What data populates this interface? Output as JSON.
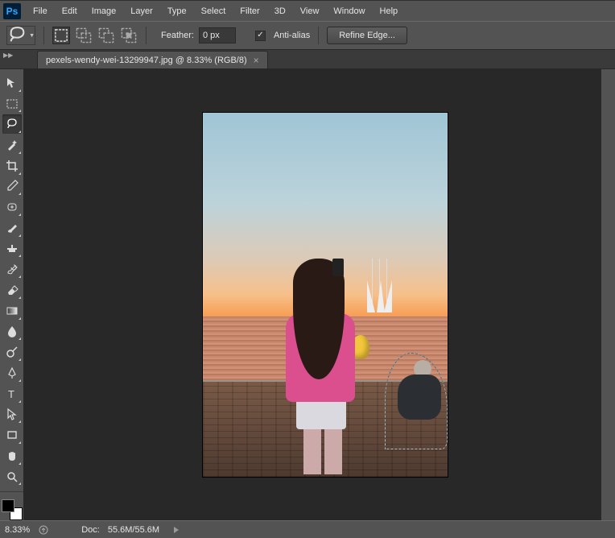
{
  "menubar": {
    "items": [
      "File",
      "Edit",
      "Image",
      "Layer",
      "Type",
      "Select",
      "Filter",
      "3D",
      "View",
      "Window",
      "Help"
    ]
  },
  "optionsbar": {
    "feather_label": "Feather:",
    "feather_value": "0 px",
    "antialias_label": "Anti-alias",
    "antialias_checked": true,
    "refine_edge_label": "Refine Edge..."
  },
  "document": {
    "tab_label": "pexels-wendy-wei-13299947.jpg @ 8.33% (RGB/8)"
  },
  "tools": [
    {
      "name": "move-tool"
    },
    {
      "name": "rectangular-marquee-tool"
    },
    {
      "name": "lasso-tool",
      "active": true
    },
    {
      "name": "magic-wand-tool"
    },
    {
      "name": "crop-tool"
    },
    {
      "name": "eyedropper-tool"
    },
    {
      "name": "healing-brush-tool"
    },
    {
      "name": "brush-tool"
    },
    {
      "name": "clone-stamp-tool"
    },
    {
      "name": "history-brush-tool"
    },
    {
      "name": "eraser-tool"
    },
    {
      "name": "gradient-tool"
    },
    {
      "name": "blur-tool"
    },
    {
      "name": "dodge-tool"
    },
    {
      "name": "pen-tool"
    },
    {
      "name": "type-tool"
    },
    {
      "name": "path-selection-tool"
    },
    {
      "name": "rectangle-shape-tool"
    },
    {
      "name": "hand-tool"
    },
    {
      "name": "zoom-tool"
    }
  ],
  "selection_mode_icons": [
    "new-selection",
    "add-to-selection",
    "subtract-from-selection",
    "intersect-selection"
  ],
  "statusbar": {
    "zoom": "8.33%",
    "doc_label": "Doc:",
    "doc_size": "55.6M/55.6M"
  },
  "colors": {
    "foreground": "#000000",
    "background": "#ffffff"
  }
}
